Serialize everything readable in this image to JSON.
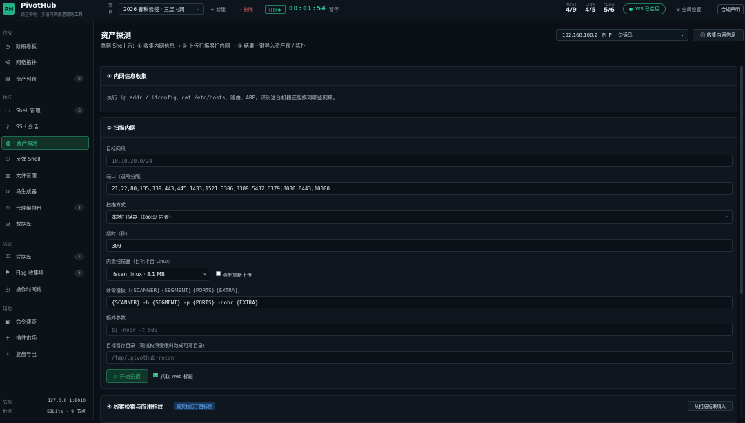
{
  "app": {
    "logo": "PH",
    "name": "PivotHub",
    "subtitle": "锁进中枢 · 多层内网渗透辅助工具"
  },
  "topbar": {
    "project_label": "项目",
    "project_value": "2026 春秋云镜 · 三层内网",
    "new_label": "+ 新建",
    "delete_label": "- 删除",
    "timer_badge": "计时中",
    "timer": "00:01:54",
    "pause_label": "暂停",
    "stats": [
      {
        "key": "HOST",
        "value": "4/9"
      },
      {
        "key": "LINK",
        "value": "4/5"
      },
      {
        "key": "FLAG",
        "value": "5/6"
      }
    ],
    "ws_status": "WS 已连接",
    "global_settings": "全局设置",
    "compliance": "合规声明"
  },
  "sidebar": {
    "sections": [
      {
        "title": "作战",
        "items": [
          {
            "icon": "dashboard-icon",
            "glyph": "◷",
            "label": "阶段看板",
            "badge": ""
          },
          {
            "icon": "topology-icon",
            "glyph": "⋲",
            "label": "网络拓扑",
            "badge": ""
          },
          {
            "icon": "asset-list-icon",
            "glyph": "▤",
            "label": "资产列表",
            "badge": "9"
          }
        ]
      },
      {
        "title": "执行",
        "items": [
          {
            "icon": "shell-icon",
            "glyph": "▭",
            "label": "Shell 管理",
            "badge": "6"
          },
          {
            "icon": "ssh-key-icon",
            "glyph": "⚷",
            "label": "SSH 会话",
            "badge": ""
          },
          {
            "icon": "globe-icon",
            "glyph": "◍",
            "label": "资产探测",
            "badge": "",
            "active": true
          },
          {
            "icon": "reverse-shell-icon",
            "glyph": "⎋",
            "label": "反弹 Shell",
            "badge": ""
          },
          {
            "icon": "file-icon",
            "glyph": "▥",
            "label": "文件管理",
            "badge": ""
          },
          {
            "icon": "code-icon",
            "glyph": "‹›",
            "label": "马生成器",
            "badge": ""
          },
          {
            "icon": "proxy-icon",
            "glyph": "⛙",
            "label": "代理编排台",
            "badge": "4"
          },
          {
            "icon": "database-icon",
            "glyph": "⛁",
            "label": "数据库",
            "badge": ""
          }
        ]
      },
      {
        "title": "沉淀",
        "items": [
          {
            "icon": "credential-key-icon",
            "glyph": "⚿",
            "label": "凭据库",
            "badge": "7"
          },
          {
            "icon": "flag-icon",
            "glyph": "⚑",
            "label": "Flag 收集墙",
            "badge": "5"
          },
          {
            "icon": "timeline-icon",
            "glyph": "◴",
            "label": "操作时间线",
            "badge": ""
          }
        ]
      },
      {
        "title": "辅助",
        "items": [
          {
            "icon": "terminal-icon",
            "glyph": "▣",
            "label": "命令速查",
            "badge": ""
          },
          {
            "icon": "plugin-icon",
            "glyph": "+",
            "label": "插件市场",
            "badge": ""
          },
          {
            "icon": "export-icon",
            "glyph": "⤓",
            "label": "复盘导出",
            "badge": ""
          }
        ]
      }
    ],
    "footer": [
      {
        "key": "后端",
        "value": "127.0.0.1:8010"
      },
      {
        "key": "数据",
        "value": "SQLite · 9 节点"
      }
    ]
  },
  "main": {
    "title": "资产探测",
    "subtitle": "拿到 Shell 后：① 收集内网信息 → ② 上传扫描器扫内网 → ③ 结果一键导入资产表 / 拓扑",
    "target_select": "192.168.100.2 · PHP 一句话马",
    "collect_button": "ⓘ 收集内网信息",
    "card1": {
      "title": "① 内网信息收集",
      "desc": "执行 ip addr / ifconfig、cat /etc/hosts、路由、ARP，识别这台机器还能摸到哪些网段。"
    },
    "card2": {
      "title": "② 扫描内网",
      "segment_label": "目标网段",
      "segment_placeholder": "10.10.20.0/24",
      "ports_label": "端口（逗号分隔）",
      "ports_value": "21,22,80,135,139,443,445,1433,1521,3306,3389,5432,6379,8080,8443,10000",
      "mode_label": "扫描方式",
      "mode_value": "本地扫描器（tools/ 内置）",
      "timeout_label": "超时（秒）",
      "timeout_value": "300",
      "builtin_label": "内置扫描器（目标平台 Linux）",
      "builtin_value": "fscan_linux · 8.1 MB",
      "force_upload_label": "强制重新上传",
      "template_label": "命令模板（{SCANNER} {SEGMENT} {PORTS} {EXTRA}）",
      "template_value": "{SCANNER} -h {SEGMENT} -p {PORTS} -nobr {EXTRA}",
      "extra_label": "额外参数",
      "extra_placeholder": "如 -nobr -t 500",
      "tmpdir_label": "目标暂存目录（靶机权限受限时改成可写目录）",
      "tmpdir_placeholder": "/tmp/.pivothub-recon",
      "start_button": "▷ 开始扫描",
      "web_title_label": "抓取 Web 标题"
    },
    "card3": {
      "title": "④ 线索检索与应用指纹",
      "badge": "真实执行于目标侧",
      "import_button": "从扫描结果填入"
    }
  }
}
